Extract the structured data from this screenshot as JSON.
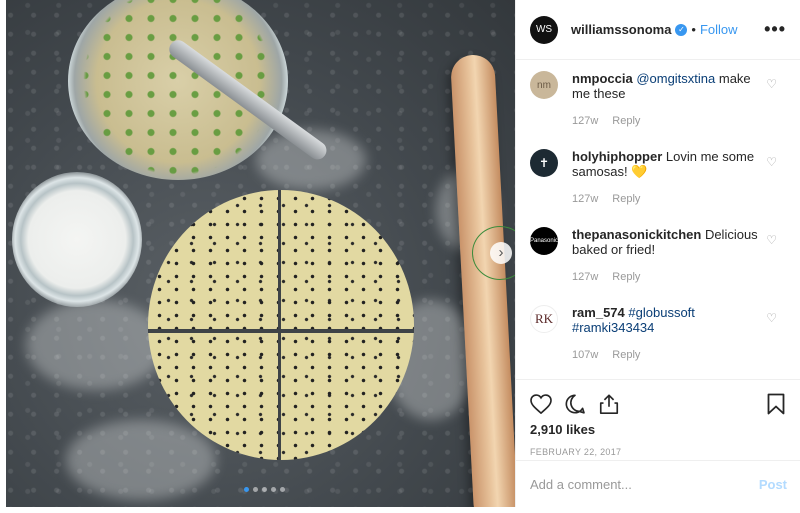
{
  "post": {
    "username": "williamssonoma",
    "avatar_initials": "WS",
    "verified_mark": "✓",
    "separator": "•",
    "follow_label": "Follow",
    "more_label": "•••",
    "likes": "2,910 likes",
    "date": "FEBRUARY 22, 2017"
  },
  "media": {
    "next_glyph": "›",
    "carousel_total": 5,
    "carousel_active": 1
  },
  "comments": [
    {
      "avatar_label": "nm",
      "username": "nmpoccia",
      "text_before": "",
      "mention": "@omgitsxtina",
      "text_after": " make me these",
      "age": "127w",
      "reply": "Reply"
    },
    {
      "avatar_label": "✝",
      "username": "holyhiphopper",
      "text_before": "Lovin me some samosas! ",
      "mention": "",
      "text_after": "💛",
      "age": "127w",
      "reply": "Reply"
    },
    {
      "avatar_label": "Panasonic",
      "username": "thepanasonickitchen",
      "text_before": "Delicious baked or fried!",
      "mention": "",
      "text_after": "",
      "age": "127w",
      "reply": "Reply"
    },
    {
      "avatar_label": "RK",
      "username": "ram_574",
      "text_before": "",
      "mention": "#globussoft #ramki343434",
      "text_after": "",
      "age": "107w",
      "reply": "Reply"
    }
  ],
  "composer": {
    "placeholder": "Add a comment...",
    "post_label": "Post"
  },
  "icons": [
    "like-icon",
    "comment-icon",
    "share-icon",
    "bookmark-icon",
    "comment-like-icon",
    "verified-icon",
    "more-options-icon",
    "next-arrow-icon"
  ]
}
